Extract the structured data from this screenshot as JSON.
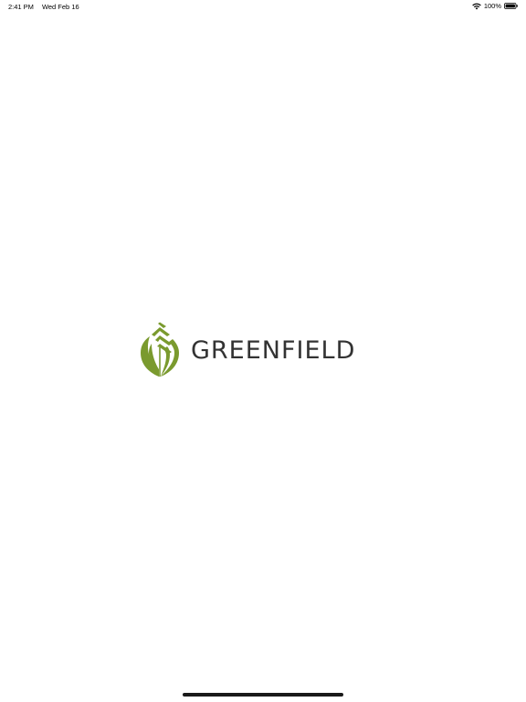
{
  "status_bar": {
    "time": "2:41 PM",
    "date": "Wed Feb 16",
    "battery": "100%",
    "wifi_icon": "wifi-icon",
    "battery_icon": "battery-icon"
  },
  "splash": {
    "brand_name": "GREENFIELD",
    "logo_icon": "leaf-icon",
    "brand_color": "#7a9a2e",
    "text_color": "#333333"
  }
}
